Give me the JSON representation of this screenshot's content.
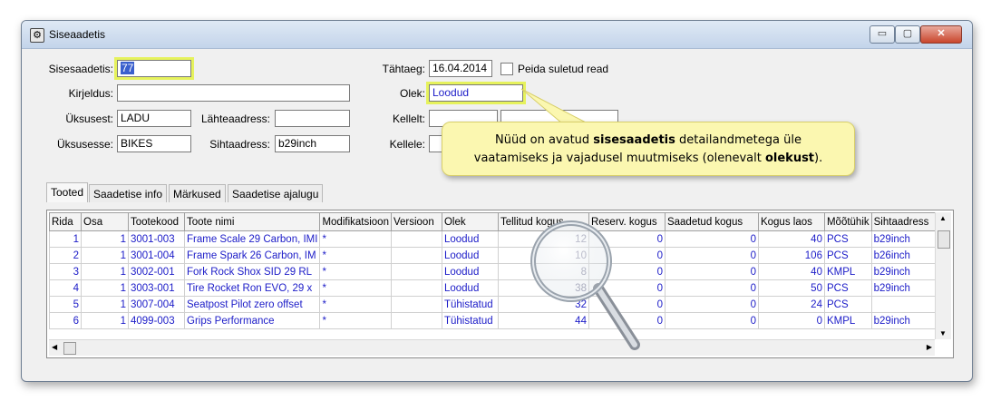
{
  "window": {
    "title": "Siseaadetis",
    "buttons": {
      "minimize": "▭",
      "maximize": "▢",
      "close": "✕"
    }
  },
  "form": {
    "sisesaadetis": {
      "label": "Sisesaadetis:",
      "value": "77"
    },
    "kirjeldus": {
      "label": "Kirjeldus:",
      "value": ""
    },
    "uksusest": {
      "label": "Üksusest:",
      "value": "LADU"
    },
    "uksusesse": {
      "label": "Üksusesse:",
      "value": "BIKES"
    },
    "lahteaadress": {
      "label": "Lähteaadress:",
      "value": ""
    },
    "sihtaadress": {
      "label": "Sihtaadress:",
      "value": "b29inch"
    },
    "tahtaeg": {
      "label": "Tähtaeg:",
      "value": "16.04.2014"
    },
    "peida": {
      "label": "Peida suletud read",
      "checked": false
    },
    "olek": {
      "label": "Olek:",
      "value": "Loodud"
    },
    "kellelt": {
      "label": "Kellelt:",
      "value": ""
    },
    "kellele": {
      "label": "Kellele:",
      "value": ""
    }
  },
  "tabs": [
    "Tooted",
    "Saadetise info",
    "Märkused",
    "Saadetise ajalugu"
  ],
  "grid": {
    "columns": [
      "Rida",
      "Osa",
      "Tootekood",
      "Toote nimi",
      "Modifikatsioon",
      "Versioon",
      "Olek",
      "Tellitud kogus",
      "Reserv. kogus",
      "Saadetud kogus",
      "Kogus laos",
      "Mõõtühik",
      "Sihtaadress"
    ],
    "rows": [
      {
        "rida": "1",
        "osa": "1",
        "kood": "3001-003",
        "nimi": "Frame Scale 29 Carbon, IMI",
        "mod": "*",
        "ver": "",
        "olek": "Loodud",
        "tellitud": "12",
        "reserv": "0",
        "saadetud": "0",
        "laos": "40",
        "uhik": "PCS",
        "siht": "b29inch"
      },
      {
        "rida": "2",
        "osa": "1",
        "kood": "3001-004",
        "nimi": "Frame Spark 26 Carbon, IM",
        "mod": "*",
        "ver": "",
        "olek": "Loodud",
        "tellitud": "10",
        "reserv": "0",
        "saadetud": "0",
        "laos": "106",
        "uhik": "PCS",
        "siht": "b26inch"
      },
      {
        "rida": "3",
        "osa": "1",
        "kood": "3002-001",
        "nimi": "Fork Rock Shox SID 29 RL",
        "mod": "*",
        "ver": "",
        "olek": "Loodud",
        "tellitud": "8",
        "reserv": "0",
        "saadetud": "0",
        "laos": "40",
        "uhik": "KMPL",
        "siht": "b29inch"
      },
      {
        "rida": "4",
        "osa": "1",
        "kood": "3003-001",
        "nimi": "Tire Rocket Ron EVO, 29 x",
        "mod": "*",
        "ver": "",
        "olek": "Loodud",
        "tellitud": "38",
        "reserv": "0",
        "saadetud": "0",
        "laos": "50",
        "uhik": "PCS",
        "siht": "b29inch"
      },
      {
        "rida": "5",
        "osa": "1",
        "kood": "3007-004",
        "nimi": "Seatpost Pilot zero offset",
        "mod": "*",
        "ver": "",
        "olek": "Tühistatud",
        "tellitud": "32",
        "reserv": "0",
        "saadetud": "0",
        "laos": "24",
        "uhik": "PCS",
        "siht": ""
      },
      {
        "rida": "6",
        "osa": "1",
        "kood": "4099-003",
        "nimi": "Grips Performance",
        "mod": "*",
        "ver": "",
        "olek": "Tühistatud",
        "tellitud": "44",
        "reserv": "0",
        "saadetud": "0",
        "laos": "0",
        "uhik": "KMPL",
        "siht": "b29inch"
      }
    ]
  },
  "callout": {
    "line1_pre": "Nüüd on avatud ",
    "line1_bold": "sisesaadetis",
    "line1_post": " detailandmetega üle",
    "line2_pre": "vaatamiseks ja vajadusel muutmiseks (olenevalt ",
    "line2_bold": "olekust",
    "line2_post": ")."
  }
}
